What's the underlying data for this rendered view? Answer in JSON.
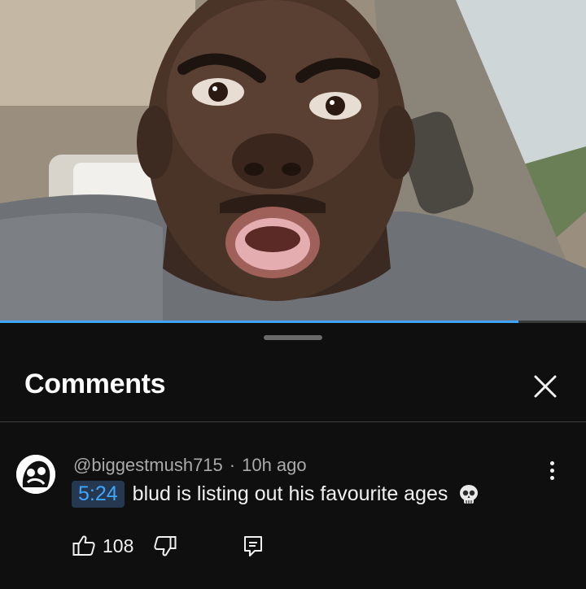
{
  "video": {
    "progress_fraction": 0.885
  },
  "comments_panel": {
    "title": "Comments",
    "close_icon": "close-icon"
  },
  "comment": {
    "author": "@biggestmush715",
    "separator": "·",
    "time_ago": "10h ago",
    "timestamp": "5:24",
    "text": "blud is listing out his favourite ages",
    "emoji_icon": "skull-emoji",
    "like_count": "108",
    "icons": {
      "like": "thumbs-up-icon",
      "dislike": "thumbs-down-icon",
      "reply": "reply-icon",
      "more": "more-vertical-icon"
    }
  },
  "colors": {
    "background": "#0f0f0f",
    "accent": "#3ea6ff",
    "timestamp_bg": "#263850",
    "secondary_text": "#aaaaaa"
  }
}
